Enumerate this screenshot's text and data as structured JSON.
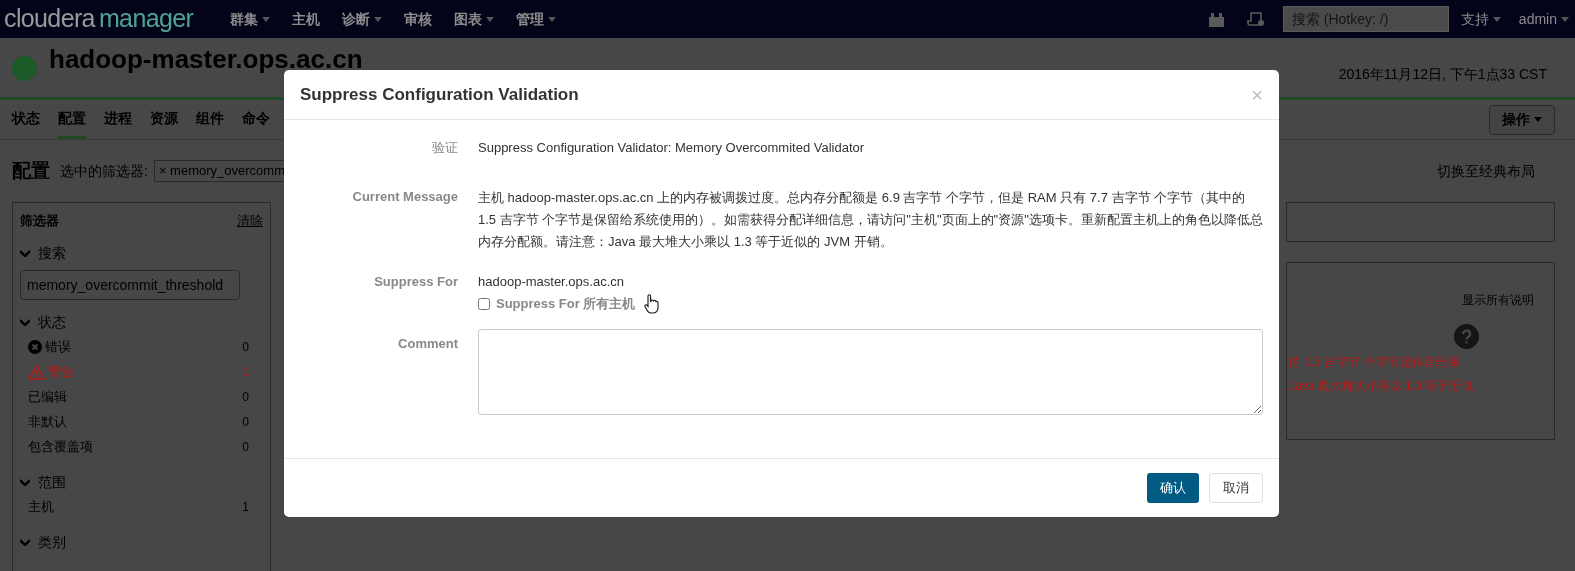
{
  "navbar": {
    "brand": {
      "part_1": "cloudera",
      "part_2": "manager"
    },
    "menus": [
      {
        "label": "群集",
        "dropdown": true
      },
      {
        "label": "主机",
        "dropdown": false
      },
      {
        "label": "诊断",
        "dropdown": true
      },
      {
        "label": "审核",
        "dropdown": false
      },
      {
        "label": "图表",
        "dropdown": true
      },
      {
        "label": "管理",
        "dropdown": true
      }
    ],
    "search": {
      "placeholder": "搜索 (Hotkey: /)"
    },
    "support": {
      "label": "支持",
      "dropdown": true
    },
    "user": {
      "label": "admin",
      "dropdown": true
    }
  },
  "host": {
    "name": "hadoop-master.ops.ac.cn",
    "date": "2016年11月12日, 下午1点33 CST"
  },
  "tabs": [
    {
      "label": "状态",
      "selected": false
    },
    {
      "label": "配置",
      "selected": true
    },
    {
      "label": "进程",
      "selected": false
    },
    {
      "label": "资源",
      "selected": false
    },
    {
      "label": "组件",
      "selected": false
    },
    {
      "label": "命令",
      "selected": false
    }
  ],
  "actions_button": "操作",
  "config": {
    "title": "配置",
    "filter_label": "选中的筛选器:",
    "filter_chip": {
      "remove": "×",
      "text": "memory_overcomm"
    },
    "switch_link": "切换至经典布局"
  },
  "sidebar": {
    "title": "筛选器",
    "clear": "清除",
    "sections": [
      {
        "title": "搜索",
        "expanded": true,
        "search_value": "memory_overcommit_threshold"
      },
      {
        "title": "状态",
        "expanded": true,
        "items": [
          {
            "label": "错误",
            "count": "0",
            "kind": "error"
          },
          {
            "label": "警告",
            "count": "1",
            "kind": "warning"
          },
          {
            "label": "已编辑",
            "count": "0",
            "kind": "plain"
          },
          {
            "label": "非默认",
            "count": "0",
            "kind": "plain"
          },
          {
            "label": "包含覆盖项",
            "count": "0",
            "kind": "plain"
          }
        ]
      },
      {
        "title": "范围",
        "expanded": true,
        "items": [
          {
            "label": "主机",
            "count": "1",
            "kind": "plain"
          }
        ]
      },
      {
        "title": "类别",
        "expanded": true
      }
    ]
  },
  "main": {
    "show_all": "显示所有说明",
    "message_lines": [
      "的 1.5 吉字节 个字节是保留给系",
      "Java 最大堆大小乘以 1.3 等于近似"
    ]
  },
  "modal": {
    "title": "Suppress Configuration Validation",
    "close": "×",
    "validator": {
      "label": "验证",
      "value": "Suppress Configuration Validator: Memory Overcommited Validator"
    },
    "current_message": {
      "label": "Current Message",
      "value": "主机 hadoop-master.ops.ac.cn 上的内存被调拨过度。总内存分配额是 6.9 吉字节 个字节，但是 RAM 只有 7.7 吉字节 个字节（其中的 1.5 吉字节 个字节是保留给系统使用的）。如需获得分配详细信息，请访问\"主机\"页面上的\"资源\"选项卡。重新配置主机上的角色以降低总内存分配额。请注意：Java 最大堆大小乘以 1.3 等于近似的 JVM 开销。"
    },
    "suppress_for": {
      "label": "Suppress For",
      "value": "hadoop-master.ops.ac.cn",
      "checkbox": {
        "label": "Suppress For 所有主机",
        "checked": false
      }
    },
    "comment": {
      "label": "Comment"
    },
    "buttons": [
      {
        "label": "确认",
        "kind": "primary"
      },
      {
        "label": "取消",
        "kind": "default"
      }
    ]
  }
}
